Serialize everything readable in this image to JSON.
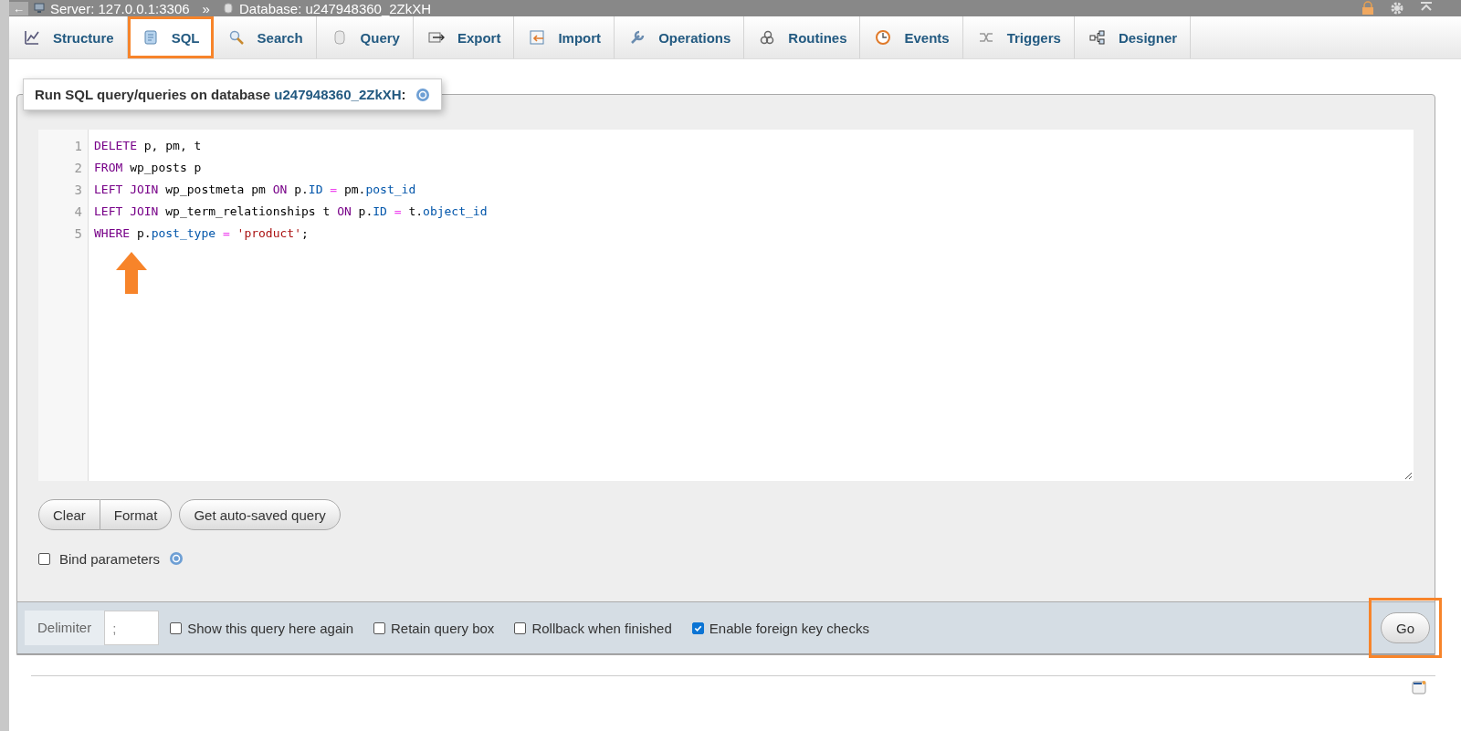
{
  "breadcrumb": {
    "back": "←",
    "server": "Server: 127.0.0.1:3306",
    "separator": "»",
    "database": "Database: u247948360_2ZkXH"
  },
  "tabs": [
    {
      "label": "Structure",
      "kind": "structure",
      "selected": false,
      "highlighted": false
    },
    {
      "label": "SQL",
      "kind": "sql",
      "selected": true,
      "highlighted": true
    },
    {
      "label": "Search",
      "kind": "search",
      "selected": false,
      "highlighted": false
    },
    {
      "label": "Query",
      "kind": "query",
      "selected": false,
      "highlighted": false
    },
    {
      "label": "Export",
      "kind": "export",
      "selected": false,
      "highlighted": false
    },
    {
      "label": "Import",
      "kind": "import",
      "selected": false,
      "highlighted": false
    },
    {
      "label": "Operations",
      "kind": "operations",
      "selected": false,
      "highlighted": false
    },
    {
      "label": "Routines",
      "kind": "routines",
      "selected": false,
      "highlighted": false
    },
    {
      "label": "Events",
      "kind": "events",
      "selected": false,
      "highlighted": false
    },
    {
      "label": "Triggers",
      "kind": "triggers",
      "selected": false,
      "highlighted": false
    },
    {
      "label": "Designer",
      "kind": "designer",
      "selected": false,
      "highlighted": false
    }
  ],
  "legend": {
    "text": "Run SQL query/queries on database ",
    "database": "u247948360_2ZkXH",
    "suffix": ":"
  },
  "editor": {
    "lines": [
      {
        "number": "1",
        "tokens": [
          {
            "kind": "keyword",
            "text": "DELETE"
          },
          {
            "kind": "plain",
            "text": " p, pm, t"
          }
        ]
      },
      {
        "number": "2",
        "tokens": [
          {
            "kind": "keyword",
            "text": "FROM"
          },
          {
            "kind": "plain",
            "text": " wp_posts p"
          }
        ]
      },
      {
        "number": "3",
        "tokens": [
          {
            "kind": "keyword",
            "text": "LEFT JOIN"
          },
          {
            "kind": "plain",
            "text": " wp_postmeta pm "
          },
          {
            "kind": "keyword",
            "text": "ON"
          },
          {
            "kind": "plain",
            "text": " p."
          },
          {
            "kind": "field",
            "text": "ID"
          },
          {
            "kind": "operator",
            "text": " = "
          },
          {
            "kind": "plain",
            "text": "pm."
          },
          {
            "kind": "field",
            "text": "post_id"
          }
        ]
      },
      {
        "number": "4",
        "tokens": [
          {
            "kind": "keyword",
            "text": "LEFT JOIN"
          },
          {
            "kind": "plain",
            "text": " wp_term_relationships t "
          },
          {
            "kind": "keyword",
            "text": "ON"
          },
          {
            "kind": "plain",
            "text": " p."
          },
          {
            "kind": "field",
            "text": "ID"
          },
          {
            "kind": "operator",
            "text": " = "
          },
          {
            "kind": "plain",
            "text": "t."
          },
          {
            "kind": "field",
            "text": "object_id"
          }
        ]
      },
      {
        "number": "5",
        "tokens": [
          {
            "kind": "keyword",
            "text": "WHERE"
          },
          {
            "kind": "plain",
            "text": " p."
          },
          {
            "kind": "field",
            "text": "post_type"
          },
          {
            "kind": "operator",
            "text": " = "
          },
          {
            "kind": "string",
            "text": "'product'"
          },
          {
            "kind": "plain",
            "text": ";"
          }
        ]
      }
    ]
  },
  "editor_buttons": [
    {
      "label": "Clear"
    },
    {
      "label": "Format"
    }
  ],
  "autosave_button": "Get auto-saved query",
  "bind_parameters": {
    "label": "Bind parameters",
    "checked": false
  },
  "footer": {
    "delimiter_label": "Delimiter",
    "delimiter_value": ";",
    "options": [
      {
        "label": "Show this query here again",
        "checked": false
      },
      {
        "label": "Retain query box",
        "checked": false
      },
      {
        "label": "Rollback when finished",
        "checked": false
      },
      {
        "label": "Enable foreign key checks",
        "checked": true
      }
    ],
    "go": {
      "label": "Go",
      "highlighted": true
    }
  }
}
